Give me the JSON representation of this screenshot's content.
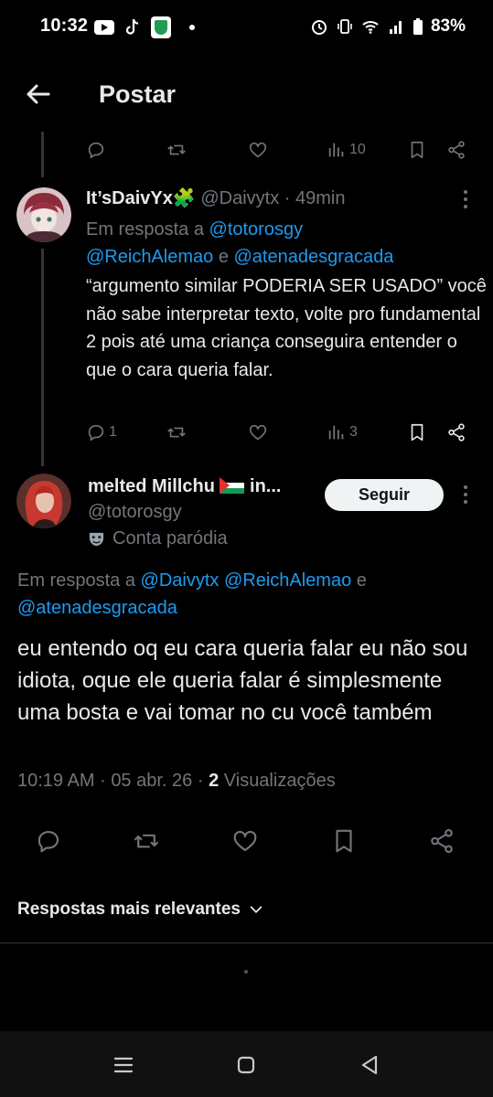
{
  "status_bar": {
    "time": "10:32",
    "battery": "83%"
  },
  "header": {
    "title": "Postar"
  },
  "prev_actions": {
    "views": "10"
  },
  "tweet1": {
    "display_name": "It’sDaivYx",
    "name_emoji": "🧩",
    "handle": "@Daivytx",
    "time": "49min",
    "reply_prefix": "Em resposta a",
    "mention1": "@totorosgy",
    "mention2": "@ReichAlemao",
    "reply_and": "e",
    "mention3": "@atenadesgracada",
    "body": "“argumento similar PODERIA SER USADO” você não sabe interpretar texto, volte pro fundamental 2 pois até uma criança conseguira entender o que o cara queria falar.",
    "replies": "1",
    "views": "3"
  },
  "tweet2": {
    "display_name": "melted Millchu",
    "name_suffix": "in...",
    "handle": "@totorosgy",
    "label": "Conta paródia",
    "follow_label": "Seguir",
    "reply_prefix": "Em resposta a",
    "mention1": "@Daivytx",
    "mention2": "@ReichAlemao",
    "reply_and": "e",
    "mention3": "@atenadesgracada",
    "body": "eu entendo oq eu cara queria falar eu não sou idiota, oque ele queria falar é simplesmente uma bosta e vai tomar no cu você também",
    "time": "10:19 AM",
    "date": "05 abr. 26",
    "views_count": "2",
    "views_label": "Visualizações"
  },
  "sort": {
    "label": "Respostas mais relevantes"
  },
  "colors": {
    "accent": "#1d9bf0",
    "muted": "#71767b",
    "text": "#e7e9ea"
  }
}
